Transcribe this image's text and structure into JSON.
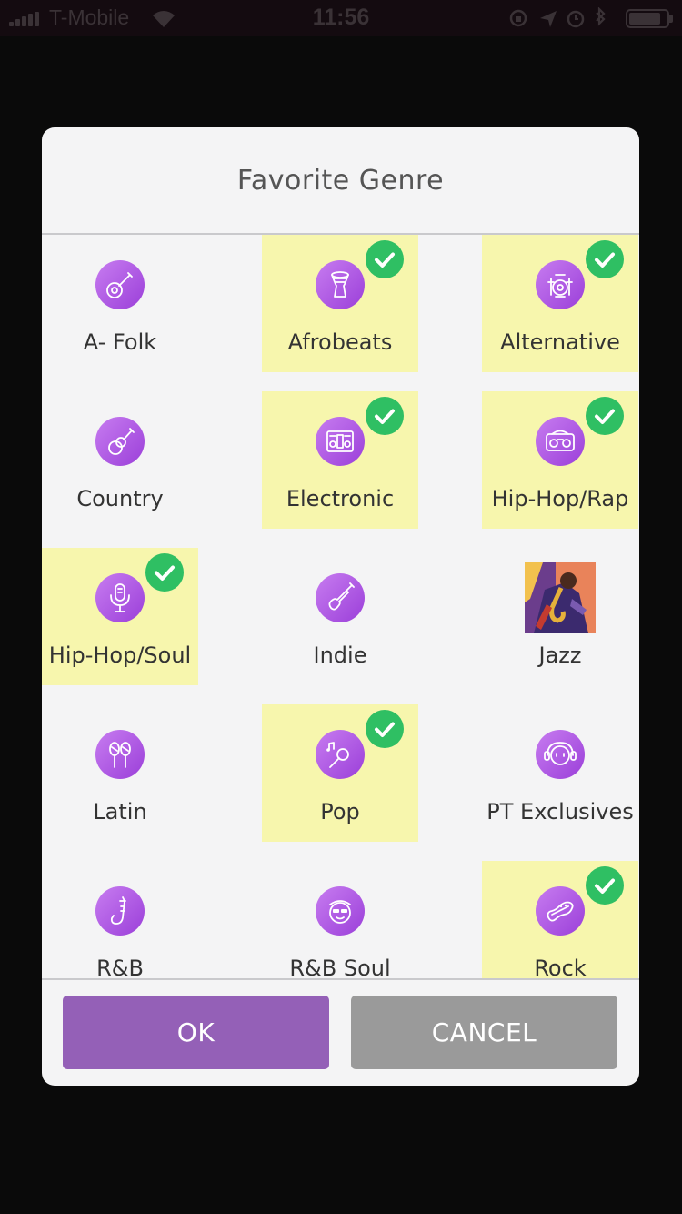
{
  "status_bar": {
    "carrier": "T-Mobile",
    "time": "11:56",
    "battery_level": 0.85,
    "icons": [
      "signal-icon",
      "wifi-icon",
      "rotation-lock-icon",
      "location-icon",
      "alarm-icon",
      "bluetooth-icon",
      "battery-icon"
    ]
  },
  "dialog": {
    "title": "Favorite Genre",
    "genres": [
      {
        "label": "A- Folk",
        "icon": "banjo-icon",
        "selected": false
      },
      {
        "label": "Afrobeats",
        "icon": "djembe-drum-icon",
        "selected": true
      },
      {
        "label": "Alternative",
        "icon": "drum-kit-icon",
        "selected": true
      },
      {
        "label": "Country",
        "icon": "acoustic-guitar-icon",
        "selected": false
      },
      {
        "label": "Electronic",
        "icon": "speakers-icon",
        "selected": true
      },
      {
        "label": "Hip-Hop/Rap",
        "icon": "boombox-icon",
        "selected": true
      },
      {
        "label": "Hip-Hop/Soul",
        "icon": "microphone-icon",
        "selected": true
      },
      {
        "label": "Indie",
        "icon": "electric-guitar-icon",
        "selected": false
      },
      {
        "label": "Jazz",
        "icon": "jazz-saxophonist-image",
        "selected": false
      },
      {
        "label": "Latin",
        "icon": "maracas-icon",
        "selected": false
      },
      {
        "label": "Pop",
        "icon": "mic-with-notes-icon",
        "selected": true
      },
      {
        "label": "PT Exclusives",
        "icon": "headphones-face-icon",
        "selected": false
      },
      {
        "label": "R&B",
        "icon": "saxophone-icon",
        "selected": false
      },
      {
        "label": "R&B Soul",
        "icon": "cool-face-icon",
        "selected": false
      },
      {
        "label": "Rock",
        "icon": "bass-guitar-icon",
        "selected": true
      }
    ],
    "ok_label": "OK",
    "cancel_label": "CANCEL"
  },
  "colors": {
    "selected_bg": "#f7f6ad",
    "check": "#2fbf63",
    "icon_purple": "#b25ce6",
    "ok_button": "#9460b7",
    "cancel_button": "#9a9a9a"
  }
}
